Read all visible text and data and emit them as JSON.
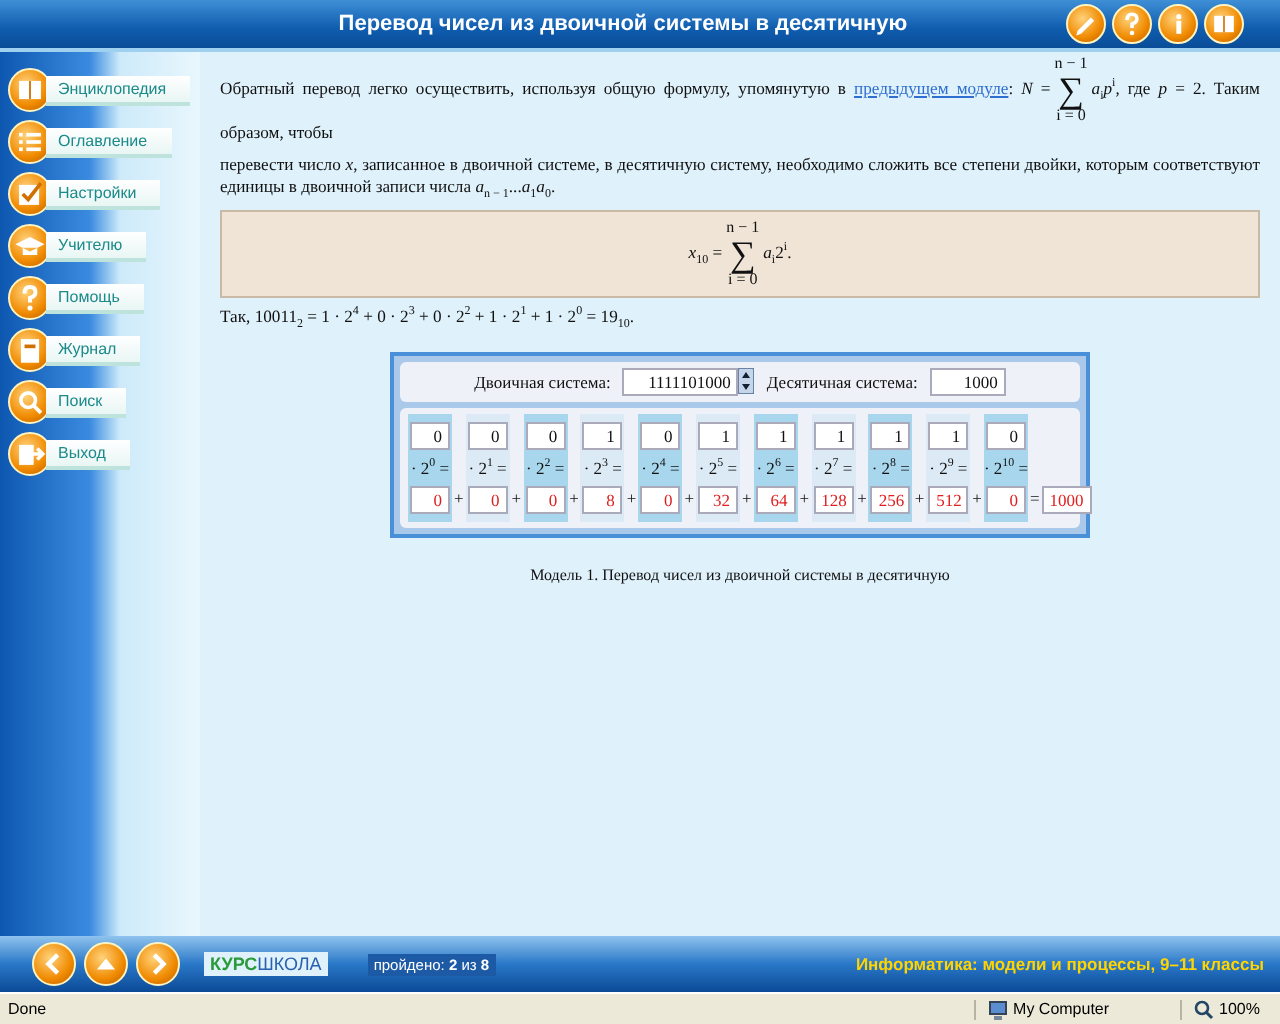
{
  "window": {
    "title": "Перевод чисел из двоичной системы в десятичную"
  },
  "toolbar_icons": [
    {
      "kind": "pencil"
    },
    {
      "kind": "help"
    },
    {
      "kind": "info"
    },
    {
      "kind": "book"
    }
  ],
  "sidebar": {
    "items": [
      {
        "label": "Энциклопедия",
        "kind": "book"
      },
      {
        "label": "Оглавление",
        "kind": "list"
      },
      {
        "label": "Настройки",
        "kind": "check"
      },
      {
        "label": "Учителю",
        "kind": "cap"
      },
      {
        "label": "Помощь",
        "kind": "help"
      },
      {
        "label": "Журнал",
        "kind": "journal"
      },
      {
        "label": "Поиск",
        "kind": "search"
      },
      {
        "label": "Выход",
        "kind": "exit"
      }
    ]
  },
  "content": {
    "intro": {
      "before": "Обратный перевод легко осуществить, используя общую формулу, упомянутую в",
      "link": "предыдущем модуле",
      "formula_lead": ": *N* =",
      "sum": {
        "upper": "n − 1",
        "symbol": "∑",
        "lower": "i = 0"
      },
      "formula_tail": "*a*$_{i}$*p*$^{i}$, где *p* = 2. Таким образом, чтобы"
    },
    "paragraph": "перевести число *x*, записанное в двоичной системе, в десятичную систему, необходимо сложить все степени двойки, которым соответствуют единицы в двоичной записи числа *a*$_{n − 1}$...*a*$_{1}$*a*$_{0}$.",
    "formula_box": {
      "lead": "*x*$_{10}$ =",
      "sum": {
        "upper": "n − 1",
        "symbol": "∑",
        "lower": "i = 0"
      },
      "tail": "*a*$_{i}$2$^{i}$."
    },
    "example": "Так, 10011$_{2}$ = 1 · 2$^{4}$ + 0 · 2$^{3}$ + 0 · 2$^{2}$ + 1 · 2$^{1}$ + 1 · 2$^{0}$ = 19$_{10}$."
  },
  "model": {
    "binary_label": "Двоичная система:",
    "binary_value": "1111101000",
    "decimal_label": "Десятичная система:",
    "decimal_value": "1000",
    "columns": [
      {
        "digit": "0",
        "power": "· 2$^{0}$ =",
        "product": "0",
        "operator": "+"
      },
      {
        "digit": "0",
        "power": "· 2$^{1}$ =",
        "product": "0",
        "operator": "+"
      },
      {
        "digit": "0",
        "power": "· 2$^{2}$ =",
        "product": "0",
        "operator": "+"
      },
      {
        "digit": "1",
        "power": "· 2$^{3}$ =",
        "product": "8",
        "operator": "+"
      },
      {
        "digit": "0",
        "power": "· 2$^{4}$ =",
        "product": "0",
        "operator": "+"
      },
      {
        "digit": "1",
        "power": "· 2$^{5}$ =",
        "product": "32",
        "operator": "+"
      },
      {
        "digit": "1",
        "power": "· 2$^{6}$ =",
        "product": "64",
        "operator": "+"
      },
      {
        "digit": "1",
        "power": "· 2$^{7}$ =",
        "product": "128",
        "operator": "+"
      },
      {
        "digit": "1",
        "power": "· 2$^{8}$ =",
        "product": "256",
        "operator": "+"
      },
      {
        "digit": "1",
        "power": "· 2$^{9}$ =",
        "product": "512",
        "operator": "+"
      },
      {
        "digit": "0",
        "power": "· 2$^{10}$ =",
        "product": "0",
        "operator": "="
      }
    ],
    "total": "1000",
    "caption": "Модель 1. Перевод чисел из двоичной системы в десятичную"
  },
  "bottom_bar": {
    "nav_buttons": [
      {
        "kind": "back"
      },
      {
        "kind": "up"
      },
      {
        "kind": "forward"
      }
    ],
    "logo": {
      "part1": "КУРС",
      "part2": "ШКОЛА"
    },
    "progress": "пройдено: **2** из **8**",
    "course": "Информатика: модели и процессы, 9–11 классы"
  },
  "status_bar": {
    "status": "Done",
    "zone": "My Computer",
    "zoom": "100%"
  }
}
